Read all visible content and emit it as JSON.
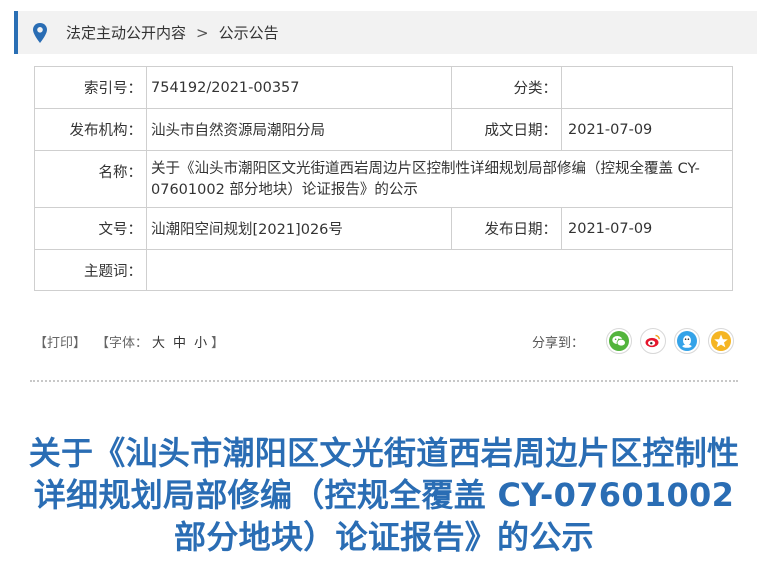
{
  "breadcrumb": {
    "items": [
      "法定主动公开内容",
      "公示公告"
    ],
    "separator": ">"
  },
  "meta": {
    "index_label": "索引号：",
    "index_value": "754192/2021-00357",
    "category_label": "分类：",
    "category_value": "",
    "publisher_label": "发布机构：",
    "publisher_value": "汕头市自然资源局潮阳分局",
    "created_label": "成文日期：",
    "created_value": "2021-07-09",
    "name_label": "名称：",
    "name_value": "关于《汕头市潮阳区文光街道西岩周边片区控制性详细规划局部修编（控规全覆盖 CY-07601002 部分地块）论证报告》的公示",
    "docno_label": "文号：",
    "docno_value": "汕潮阳空间规划[2021]026号",
    "published_label": "发布日期：",
    "published_value": "2021-07-09",
    "subject_label": "主题词：",
    "subject_value": ""
  },
  "toolbar": {
    "print": "【打印】",
    "font_prefix": "【字体：",
    "font_large": "大",
    "font_medium": "中",
    "font_small": "小",
    "font_suffix": "】",
    "share_label": "分享到："
  },
  "share_icons": [
    "wechat-icon",
    "weibo-icon",
    "qq-icon",
    "qzone-icon"
  ],
  "colors": {
    "accent": "#2a6db4",
    "wechat": "#52b43c",
    "weibo": "#e6162d",
    "qq": "#35a3e8",
    "qzone": "#f5b523"
  },
  "title": "关于《汕头市潮阳区文光街道西岩周边片区控制性详细规划局部修编（控规全覆盖 CY-07601002 部分地块）论证报告》的公示"
}
